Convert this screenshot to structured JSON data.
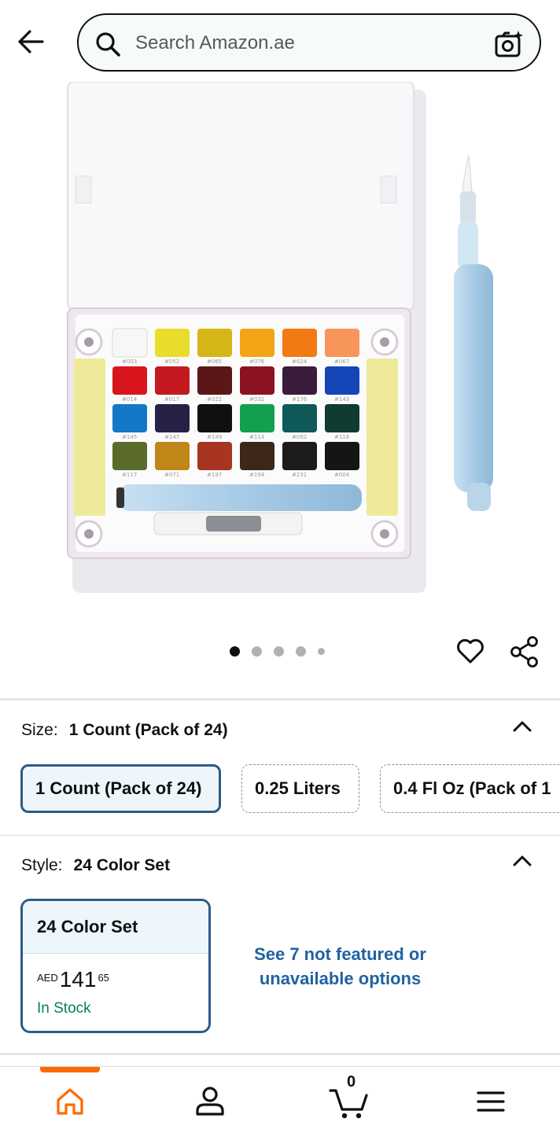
{
  "header": {
    "back_icon": "arrow-left-icon",
    "search_placeholder": "Search Amazon.ae",
    "camera_icon": "camera-sparkle-icon"
  },
  "gallery": {
    "image_alt": "Watercolor paint set with 24 colors and water brush pen",
    "dots_count": 5,
    "active_dot": 0,
    "wishlist_icon": "heart-icon",
    "share_icon": "share-icon",
    "swatch_codes": [
      "#003",
      "#052",
      "#065",
      "#076",
      "#024",
      "#067",
      "#014",
      "#017",
      "#022",
      "#032",
      "#176",
      "#143",
      "#145",
      "#147",
      "#149",
      "#114",
      "#092",
      "#116",
      "#117",
      "#071",
      "#197",
      "#194",
      "#231",
      "#004"
    ]
  },
  "size": {
    "label": "Size:",
    "value": "1 Count (Pack of 24)",
    "options": [
      "1 Count (Pack of 24)",
      "0.25 Liters",
      "0.4 Fl Oz (Pack of 1"
    ]
  },
  "style": {
    "label": "Style:",
    "value": "24 Color Set",
    "card": {
      "title": "24 Color Set",
      "currency": "AED",
      "price_whole": "141",
      "price_fraction": "65",
      "stock": "In Stock"
    },
    "see_more_line1": "See 7 not featured or",
    "see_more_line2": "unavailable options"
  },
  "bottom_nav": {
    "items": [
      "home-icon",
      "account-icon",
      "cart-icon",
      "menu-icon"
    ],
    "active": "home",
    "cart_count": "0"
  },
  "colors": {
    "accent_orange": "#ff6a00",
    "selected_border": "#2d5b86",
    "link_blue": "#2162a1",
    "in_stock_green": "#067d62"
  }
}
